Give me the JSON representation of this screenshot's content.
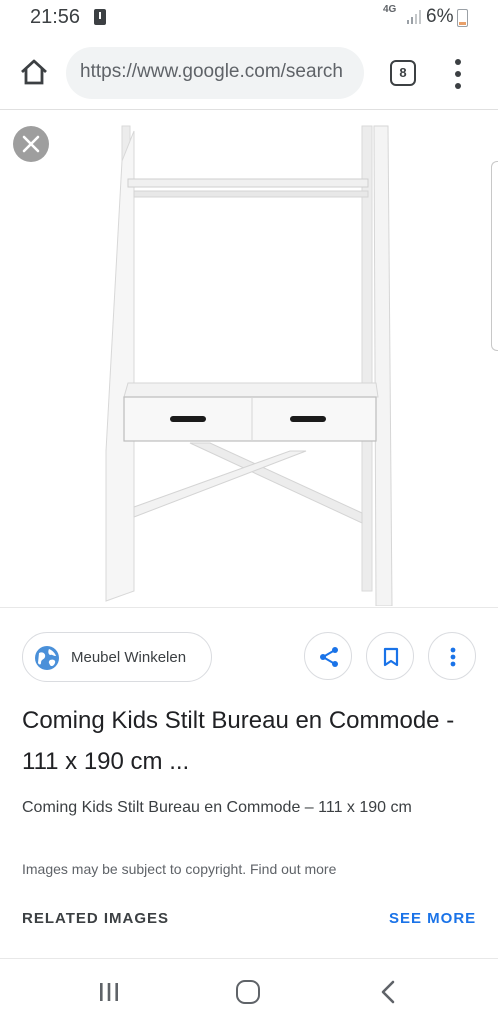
{
  "status_bar": {
    "time": "21:56",
    "network": "4G",
    "battery": "6%"
  },
  "toolbar": {
    "url": "https://www.google.com/search",
    "tab_count": "8"
  },
  "image_viewer": {
    "icons": {
      "close": "close-icon"
    }
  },
  "result": {
    "source_name": "Meubel Winkelen",
    "title": "Coming Kids Stilt Bureau en Commode - 111 x 190 cm ...",
    "subtitle": "Coming Kids Stilt Bureau en Commode – 111 x 190 cm",
    "copyright": "Images may be subject to copyright. Find out more",
    "icons": {
      "source": "globe-icon",
      "share": "share-icon",
      "save": "bookmark-icon",
      "more": "more-vert-icon"
    }
  },
  "related": {
    "label": "RELATED IMAGES",
    "see_more": "SEE MORE"
  },
  "colors": {
    "accent": "#1a73e8",
    "globe": "#4a90d9"
  }
}
